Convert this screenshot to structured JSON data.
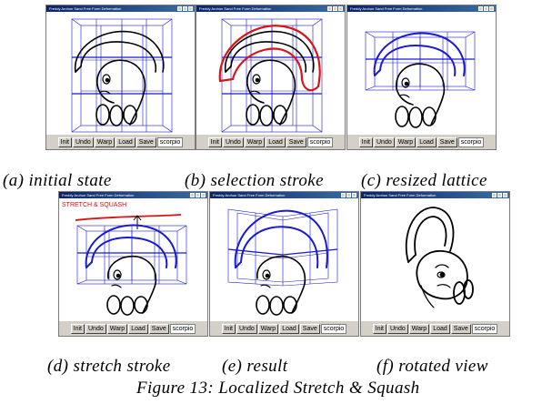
{
  "window_title": "Freddy Arohun Sand Free Form Deformation",
  "buttons": {
    "init": "Init",
    "undo": "Undo",
    "warp": "Warp",
    "load": "Load",
    "save": "Save",
    "filename": "scorpio"
  },
  "panel_d_label": "STRETCH & SQUASH",
  "captions": {
    "a": "(a) initial state",
    "b": "(b) selection stroke",
    "c": "(c) resized lattice",
    "d": "(d) stretch stroke",
    "e": "(e) result",
    "f": "(f) rotated view"
  },
  "figure_caption": "Figure 13:  Localized Stretch & Squash",
  "colors": {
    "lattice": "#1a1ad0",
    "selection_stroke": "#d81414",
    "drawing": "#000000",
    "button_face": "#d4d0c8"
  }
}
